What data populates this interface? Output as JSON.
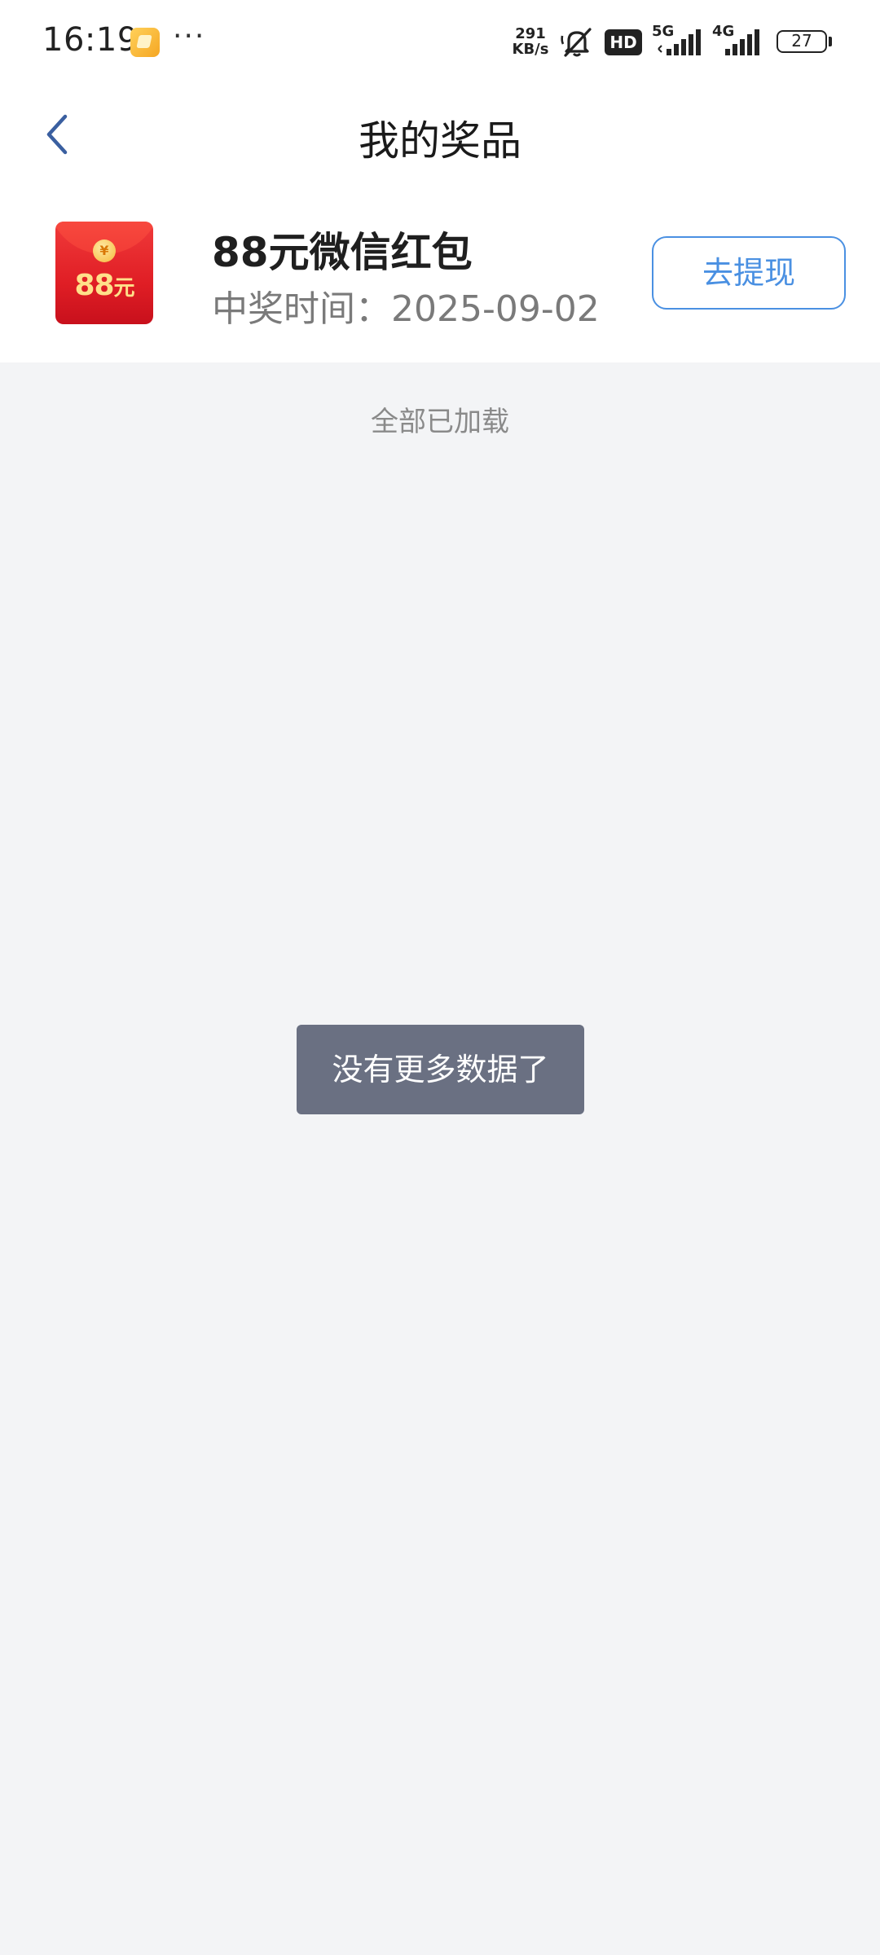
{
  "status_bar": {
    "time": "16:19",
    "app_notification_icon": "gallery-app-icon",
    "more_indicator": "···",
    "net_speed_value": "291",
    "net_speed_unit": "KB/s",
    "mute_icon": "bell-off-icon",
    "hd_label": "HD",
    "signal_1_label": "5G",
    "signal_2_label": "4G",
    "battery_level": "27"
  },
  "nav": {
    "back_icon": "chevron-left-icon",
    "title": "我的奖品"
  },
  "prize": {
    "image_amount": "88",
    "image_unit": "元",
    "image_coin_symbol": "¥",
    "name": "88元微信红包",
    "date_text": "中奖时间：2025-09-02",
    "action_label": "去提现"
  },
  "list": {
    "end_text": "全部已加载"
  },
  "toast": {
    "message": "没有更多数据了"
  },
  "colors": {
    "accent": "#4a90e2",
    "back_arrow": "#3a5fa0",
    "page_background": "#f3f4f6",
    "toast_background": "#6a7082",
    "red_packet": "#e01e25"
  }
}
